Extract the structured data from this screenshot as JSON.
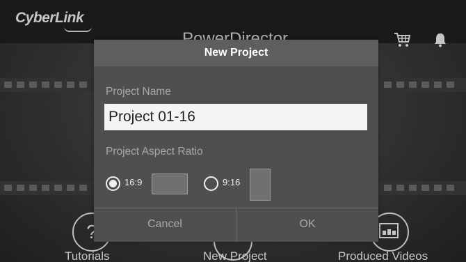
{
  "app": {
    "logo_text": "CyberLink",
    "background_title": "PowerDirector"
  },
  "top_icons": [
    "cart-icon",
    "bell-icon"
  ],
  "bottom_nav": {
    "tutorials_label": "Tutorials",
    "new_project_label": "New Project",
    "produced_videos_label": "Produced Videos",
    "tutorials_glyph": "?"
  },
  "dialog": {
    "title": "New Project",
    "name_label": "Project Name",
    "name_value": "Project 01-16",
    "ratio_label": "Project Aspect Ratio",
    "options": [
      {
        "label": "16:9",
        "selected": true
      },
      {
        "label": "9:16",
        "selected": false
      }
    ],
    "cancel_label": "Cancel",
    "ok_label": "OK"
  },
  "colors": {
    "dialog_bg": "#4f4f4f",
    "dialog_header": "#5e5e5e",
    "input_bg": "#f4f4f4",
    "accent_white": "#f0f0f0"
  }
}
